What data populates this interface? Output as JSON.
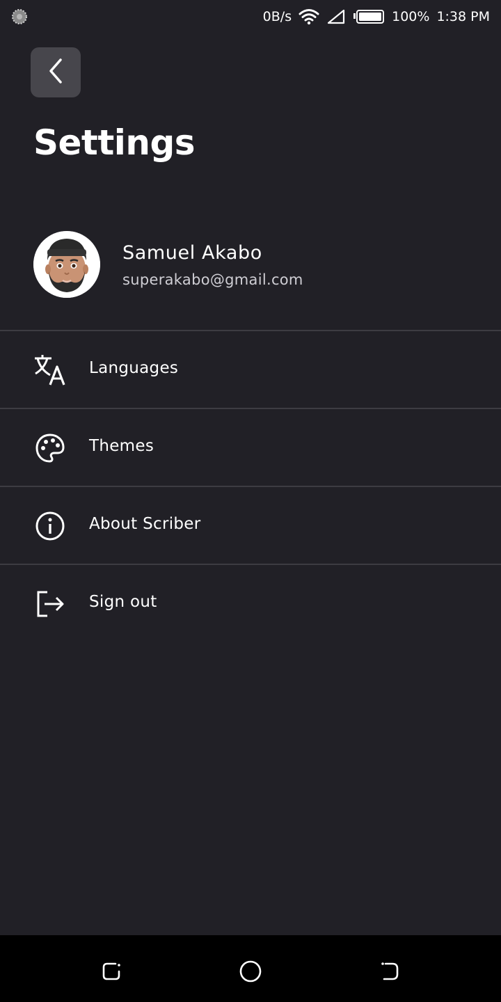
{
  "status_bar": {
    "net_speed": "0B/s",
    "battery": "100%",
    "time": "1:38 PM"
  },
  "header": {
    "title": "Settings",
    "back_icon": "chevron-left-icon"
  },
  "profile": {
    "name": "Samuel Akabo",
    "email": "superakabo@gmail.com"
  },
  "menu": [
    {
      "label": "Languages",
      "icon": "translate-icon"
    },
    {
      "label": "Themes",
      "icon": "palette-icon"
    },
    {
      "label": "About Scriber",
      "icon": "info-icon"
    },
    {
      "label": "Sign out",
      "icon": "sign-out-icon"
    }
  ],
  "colors": {
    "background": "#212026",
    "back_button": "#47464c",
    "divider": "#3d3c42",
    "nav_bar": "#000000"
  }
}
